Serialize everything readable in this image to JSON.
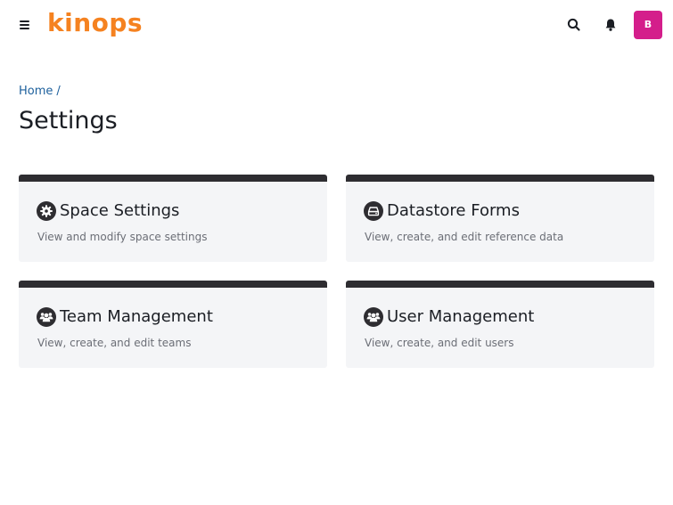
{
  "header": {
    "logo_text": "kinops",
    "logo_color": "#f58220",
    "menu_icon": "hamburger-menu-icon",
    "search_icon": "search-icon",
    "notifications_icon": "bell-icon",
    "avatar_initial": "B",
    "avatar_color": "#d41e8b"
  },
  "breadcrumb": {
    "home_label": "Home",
    "separator": "/"
  },
  "page": {
    "title": "Settings"
  },
  "cards": [
    {
      "title": "Space Settings",
      "description": "View and modify space settings",
      "icon": "gear-icon"
    },
    {
      "title": "Datastore Forms",
      "description": "View, create, and edit reference data",
      "icon": "hard-drive-icon"
    },
    {
      "title": "Team Management",
      "description": "View, create, and edit teams",
      "icon": "users-icon"
    },
    {
      "title": "User Management",
      "description": "View, create, and edit users",
      "icon": "users-icon"
    }
  ],
  "colors": {
    "card_background": "#f4f5f7",
    "card_accent": "#2e2d31",
    "link": "#1c5f9c"
  }
}
